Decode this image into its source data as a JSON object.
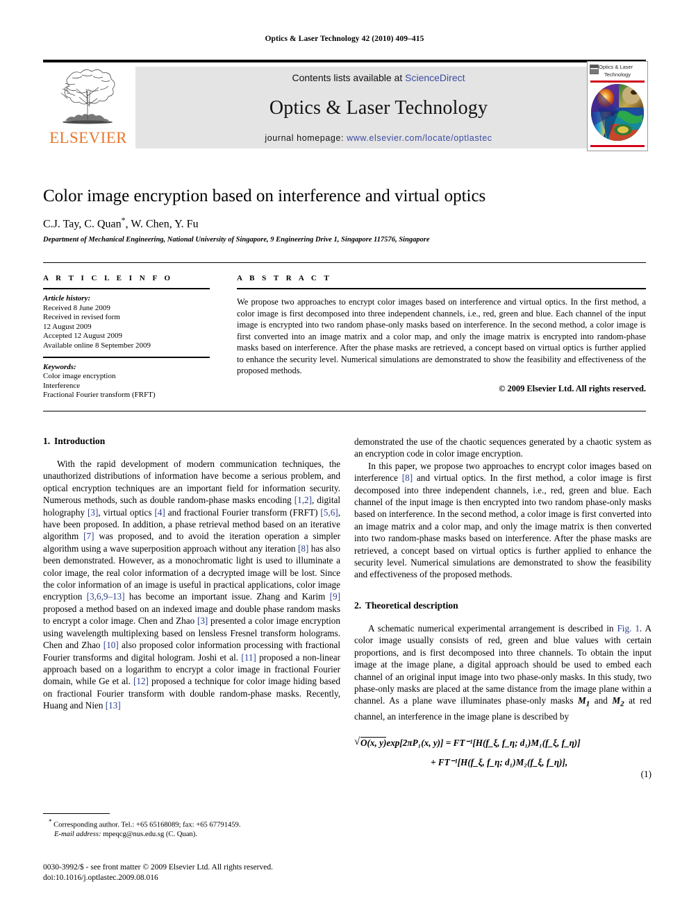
{
  "running_head": "Optics & Laser Technology 42 (2010) 409–415",
  "masthead": {
    "contents_prefix": "Contents lists available at ",
    "sciencedirect_link": "ScienceDirect",
    "journal_title": "Optics & Laser Technology",
    "homepage_prefix": "journal homepage: ",
    "homepage_link": "www.elsevier.com/locate/optlastec",
    "publisher_logo_text": "ELSEVIER"
  },
  "cover": {
    "title_line1": "Optics & Laser",
    "title_line2": "Technology",
    "accent_color": "#D0021B"
  },
  "article": {
    "title": "Color image encryption based on interference and virtual optics",
    "authors": "C.J. Tay, C. Quan",
    "authors_corresponding_marker": "*",
    "authors_rest": ", W. Chen, Y. Fu",
    "affiliation": "Department of Mechanical Engineering, National University of Singapore, 9 Engineering Drive 1, Singapore 117576, Singapore"
  },
  "info": {
    "heading": "A R T I C L E   I N F O",
    "history_label": "Article history:",
    "history_lines": [
      "Received 8 June 2009",
      "Received in revised form",
      "12 August 2009",
      "Accepted 12 August 2009",
      "Available online 8 September 2009"
    ],
    "keywords_label": "Keywords:",
    "keywords": [
      "Color image encryption",
      "Interference",
      "Fractional Fourier transform (FRFT)"
    ]
  },
  "abstract": {
    "heading": "A B S T R A C T",
    "text": "We propose two approaches to encrypt color images based on interference and virtual optics. In the first method, a color image is first decomposed into three independent channels, i.e., red, green and blue. Each channel of the input image is encrypted into two random phase-only masks based on interference. In the second method, a color image is first converted into an image matrix and a color map, and only the image matrix is encrypted into random-phase masks based on interference. After the phase masks are retrieved, a concept based on virtual optics is further applied to enhance the security level. Numerical simulations are demonstrated to show the feasibility and effectiveness of the proposed methods.",
    "copyright": "© 2009 Elsevier Ltd. All rights reserved."
  },
  "sections": {
    "intro": {
      "number": "1.",
      "title": "Introduction",
      "p1_a": "With the rapid development of modern communication techniques, the unauthorized distributions of information have become a serious problem, and optical encryption techniques are an important field for information security. Numerous methods, such as double random-phase masks encoding ",
      "ref_1_2": "[1,2]",
      "p1_b": ", digital holography ",
      "ref_3": "[3]",
      "p1_c": ", virtual optics ",
      "ref_4": "[4]",
      "p1_d": " and fractional Fourier transform (FRFT) ",
      "ref_5_6": "[5,6]",
      "p1_e": ", have been proposed. In addition, a phase retrieval method based on an iterative algorithm ",
      "ref_7": "[7]",
      "p1_f": " was proposed, and to avoid the iteration operation a simpler algorithm using a wave superposition approach without any iteration ",
      "ref_8": "[8]",
      "p1_g": " has also been demonstrated. However, as a monochromatic light is used to illuminate a color image, the real color information of a decrypted image will be lost. Since the color information of an image is useful in practical applications, color image encryption ",
      "ref_3_6_9_13": "[3,6,9–13]",
      "p1_h": " has become an important issue. Zhang and Karim ",
      "ref_9": "[9]",
      "p1_i": " proposed a method based on an indexed image and double phase random masks to encrypt a color image. Chen and Zhao ",
      "ref_3b": "[3]",
      "p1_j": " presented a color image encryption using wavelength multiplexing based on lensless Fresnel transform holograms. Chen and Zhao ",
      "ref_10": "[10]",
      "p1_k": " also proposed color information processing with fractional Fourier transforms and digital hologram. Joshi et al. ",
      "ref_11": "[11]",
      "p1_l": " proposed a non-linear approach based on a logarithm to encrypt a color image in fractional Fourier domain, while Ge et al. ",
      "ref_12": "[12]",
      "p1_m": " proposed a technique for color image hiding based on fractional Fourier transform with double random-phase masks. Recently, Huang and Nien ",
      "ref_13": "[13]",
      "p1_n": " demonstrated the use of the chaotic sequences generated by a chaotic system as an encryption code in color image encryption.",
      "p2_a": "In this paper, we propose two approaches to encrypt color images based on interference ",
      "p2_ref_8": "[8]",
      "p2_b": " and virtual optics. In the first method, a color image is first decomposed into three independent channels, i.e., red, green and blue. Each channel of the input image is then encrypted into two random phase-only masks based on interference. In the second method, a color image is first converted into an image matrix and a color map, and only the image matrix is then converted into two random-phase masks based on interference. After the phase masks are retrieved, a concept based on virtual optics is further applied to enhance the security level. Numerical simulations are demonstrated to show the feasibility and effectiveness of the proposed methods."
    },
    "theory": {
      "number": "2.",
      "title": "Theoretical description",
      "p1_a": "A schematic numerical experimental arrangement is described in ",
      "fig_ref": "Fig. 1",
      "p1_b": ". A color image usually consists of red, green and blue values with certain proportions, and is first decomposed into three channels. To obtain the input image at the image plane, a digital approach should be used to embed each channel of an original input image into two phase-only masks. In this study, two phase-only masks are placed at the same distance from the image plane within a channel. As a plane wave illuminates phase-only masks ",
      "mask_m1": "M",
      "mask_m1_sub": "1",
      "p1_c": " and ",
      "mask_m2": "M",
      "mask_m2_sub": "2",
      "p1_d": " at red channel, an interference in the image plane is described by"
    }
  },
  "equation_1": {
    "lhs_radicand": "O(x, y)",
    "lhs_rest": "exp[2πP₁(x, y)] = FT⁻¹[H(f_ξ, f_η; d₁)M₁(f_ξ, f_η)]",
    "line1_plain": "exp[2πP",
    "line2": "+ FT⁻¹[H(f_ξ, f_η; d₁)M₂(f_ξ, f_η)],",
    "number": "(1)"
  },
  "footnote": {
    "marker": "*",
    "line1": " Corresponding author. Tel.: +65 65168089; fax: +65 67791459.",
    "email_label": "E-mail address:",
    "email_value": " mpeqcg@nus.edu.sg (C. Quan)."
  },
  "imprint": {
    "line1": "0030-3992/$ - see front matter © 2009 Elsevier Ltd. All rights reserved.",
    "line2": "doi:10.1016/j.optlastec.2009.08.016"
  }
}
